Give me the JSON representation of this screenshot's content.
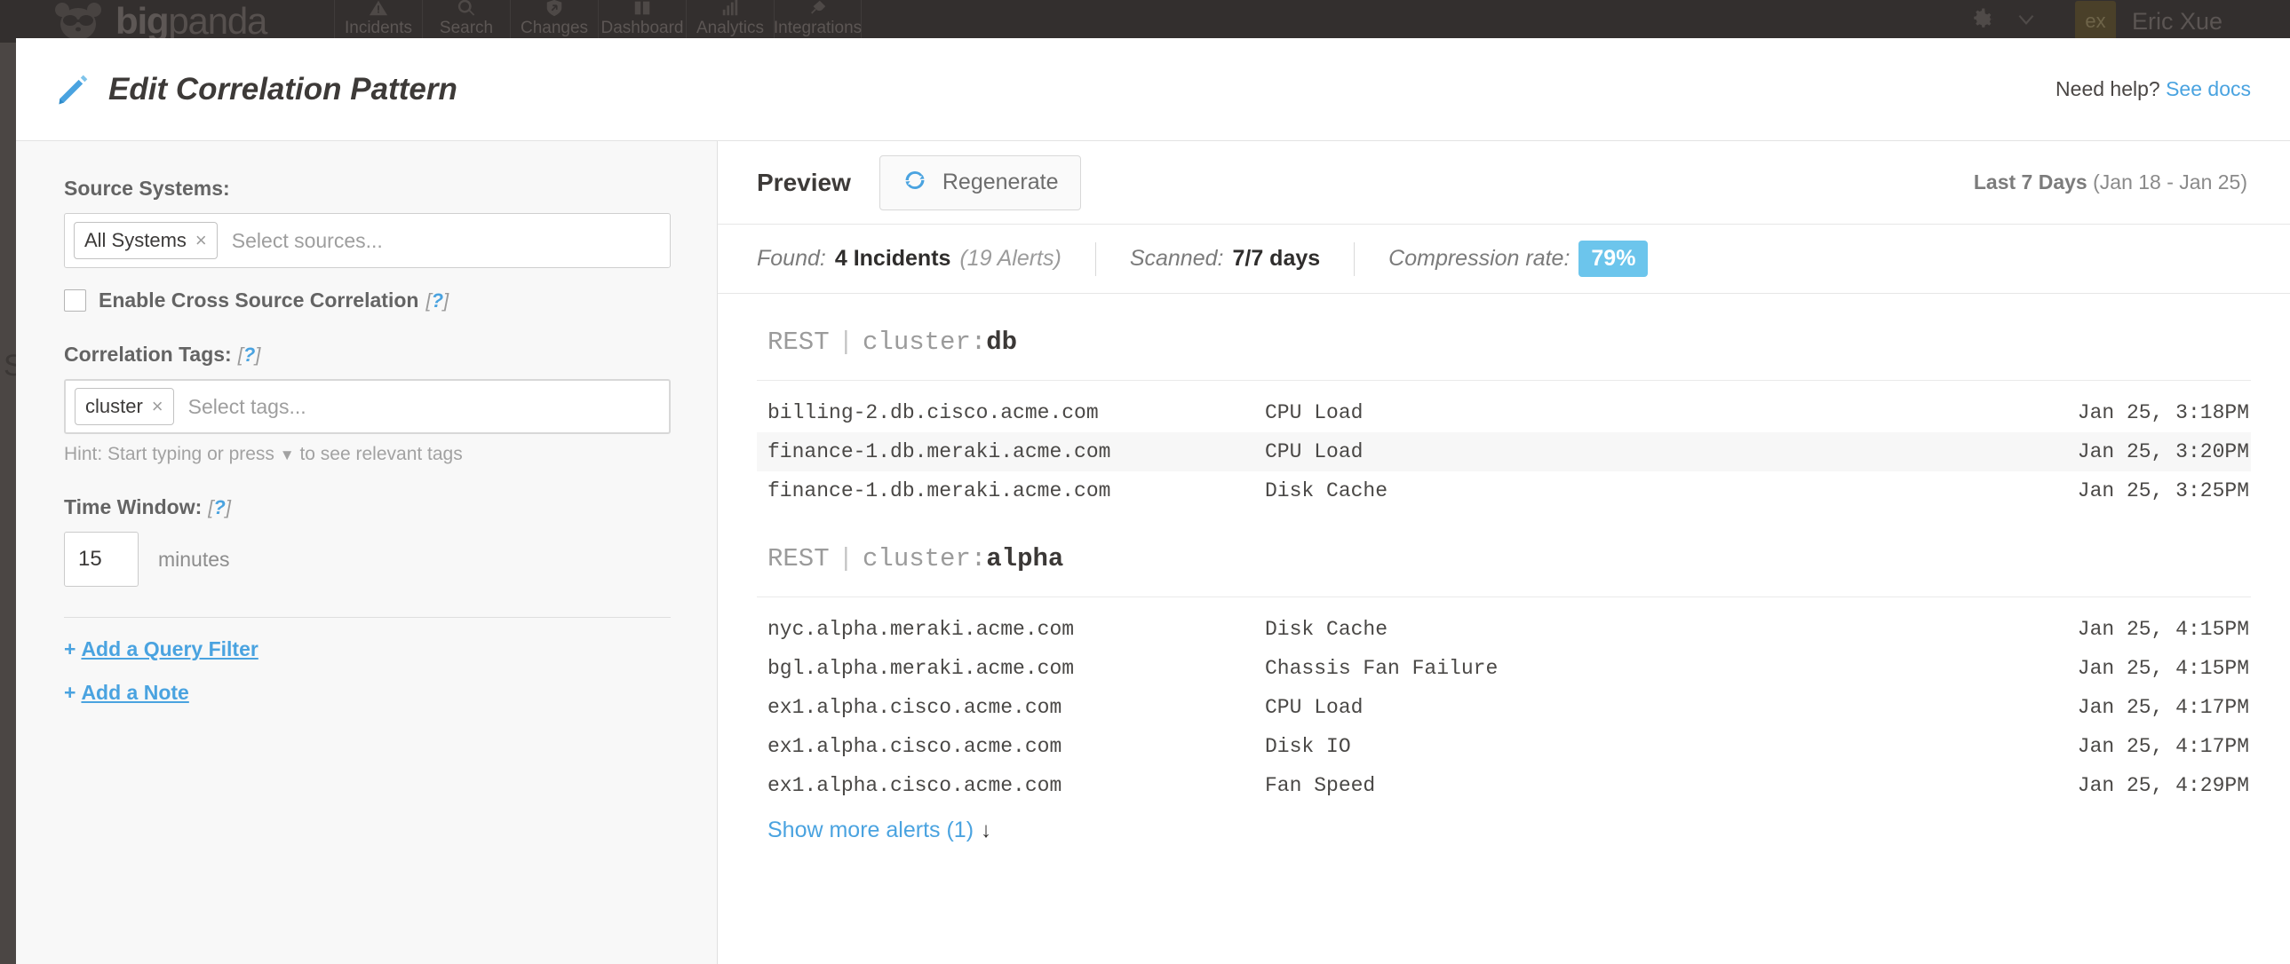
{
  "topnav": {
    "brand_bold": "big",
    "brand_thin": "panda",
    "items": [
      {
        "label": "Incidents",
        "icon": "alert-triangle-icon"
      },
      {
        "label": "Search",
        "icon": "search-icon"
      },
      {
        "label": "Changes",
        "icon": "shield-arrow-icon"
      },
      {
        "label": "Dashboard",
        "icon": "dashboard-blocks-icon"
      },
      {
        "label": "Analytics",
        "icon": "bar-chart-icon"
      },
      {
        "label": "Integrations",
        "icon": "plug-icon"
      }
    ],
    "gear_icon": "gear-icon",
    "chevron_icon": "chevron-down-icon",
    "avatar_initials": "ex",
    "user_name": "Eric Xue"
  },
  "backdrop": {
    "ghost_text": "SE"
  },
  "modal": {
    "pencil_icon": "pencil-icon",
    "title": "Edit Correlation Pattern",
    "need_help_text": "Need help?",
    "need_help_link": "See docs"
  },
  "form": {
    "source_systems": {
      "label": "Source Systems:",
      "chip": "All Systems",
      "chip_remove": "×",
      "placeholder": "Select sources..."
    },
    "cross_source": {
      "label": "Enable Cross Source Correlation",
      "help": "[?]",
      "checked": false
    },
    "correlation_tags": {
      "label": "Correlation Tags:",
      "help": "[?]",
      "chip": "cluster",
      "chip_remove": "×",
      "placeholder": "Select tags...",
      "hint_before": "Hint: Start typing or press",
      "hint_caret": "▼",
      "hint_after": "to see relevant tags"
    },
    "time_window": {
      "label": "Time Window:",
      "help": "[?]",
      "value": "15",
      "unit": "minutes"
    },
    "add_query_filter": {
      "plus": "+",
      "label": "Add a Query Filter"
    },
    "add_note": {
      "plus": "+",
      "label": "Add a Note"
    }
  },
  "preview": {
    "title": "Preview",
    "regenerate_label": "Regenerate",
    "regenerate_icon": "refresh-icon",
    "range_bold": "Last 7 Days",
    "range_detail": "(Jan 18 - Jan 25)",
    "stats": {
      "found_label": "Found:",
      "found_value": "4 Incidents",
      "found_sub": "(19 Alerts)",
      "scanned_label": "Scanned:",
      "scanned_value": "7/7 days",
      "compression_label": "Compression rate:",
      "compression_value": "79%",
      "compression_color": "#6cc5ec"
    },
    "groups": [
      {
        "source": "REST",
        "pipe": "|",
        "tag_key": "cluster:",
        "tag_value": "db",
        "alerts": [
          {
            "host": "billing-2.db.cisco.acme.com",
            "check": "CPU Load",
            "time": "Jan 25, 3:18PM",
            "hover": false
          },
          {
            "host": "finance-1.db.meraki.acme.com",
            "check": "CPU Load",
            "time": "Jan 25, 3:20PM",
            "hover": true
          },
          {
            "host": "finance-1.db.meraki.acme.com",
            "check": "Disk Cache",
            "time": "Jan 25, 3:25PM",
            "hover": false
          }
        ],
        "show_more": null
      },
      {
        "source": "REST",
        "pipe": "|",
        "tag_key": "cluster:",
        "tag_value": "alpha",
        "alerts": [
          {
            "host": "nyc.alpha.meraki.acme.com",
            "check": "Disk Cache",
            "time": "Jan 25, 4:15PM",
            "hover": false
          },
          {
            "host": "bgl.alpha.meraki.acme.com",
            "check": "Chassis Fan Failure",
            "time": "Jan 25, 4:15PM",
            "hover": false
          },
          {
            "host": "ex1.alpha.cisco.acme.com",
            "check": "CPU Load",
            "time": "Jan 25, 4:17PM",
            "hover": false
          },
          {
            "host": "ex1.alpha.cisco.acme.com",
            "check": "Disk IO",
            "time": "Jan 25, 4:17PM",
            "hover": false
          },
          {
            "host": "ex1.alpha.cisco.acme.com",
            "check": "Fan Speed",
            "time": "Jan 25, 4:29PM",
            "hover": false
          }
        ],
        "show_more": {
          "label": "Show more alerts (1)",
          "arrow": "↓"
        }
      }
    ]
  }
}
